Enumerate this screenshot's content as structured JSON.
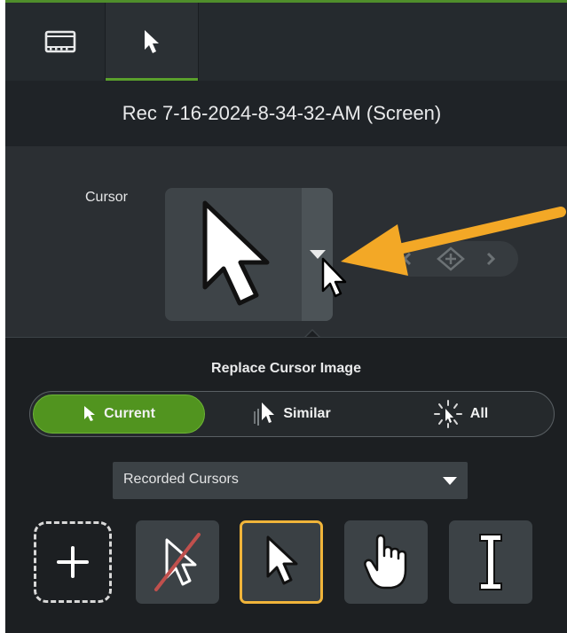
{
  "tabs": [
    {
      "name": "media",
      "icon": "film-icon"
    },
    {
      "name": "cursor",
      "icon": "cursor-arrow-icon",
      "active": true
    }
  ],
  "header": {
    "title": "Rec 7-16-2024-8-34-32-AM (Screen)"
  },
  "cursor_section": {
    "label": "Cursor",
    "preview_icon": "cursor-arrow-icon"
  },
  "popover": {
    "title": "Replace Cursor Image",
    "segments": [
      {
        "label": "Current",
        "icon": "cursor-arrow-icon",
        "active": true
      },
      {
        "label": "Similar",
        "icon": "similar-cursor-icon",
        "active": false
      },
      {
        "label": "All",
        "icon": "all-cursors-icon",
        "active": false
      }
    ],
    "dropdown": {
      "selected": "Recorded Cursors"
    },
    "tiles": [
      {
        "name": "add",
        "icon": "plus-icon"
      },
      {
        "name": "no-cursor",
        "icon": "no-cursor-icon"
      },
      {
        "name": "arrow",
        "icon": "cursor-arrow-icon",
        "selected": true
      },
      {
        "name": "hand",
        "icon": "hand-pointer-icon"
      },
      {
        "name": "ibeam",
        "icon": "text-ibeam-icon"
      }
    ]
  },
  "colors": {
    "accent_green": "#51941f",
    "selected_outline": "#f0b43a",
    "annotation_arrow": "#f3a826",
    "panel_bg": "#2b2f33"
  }
}
